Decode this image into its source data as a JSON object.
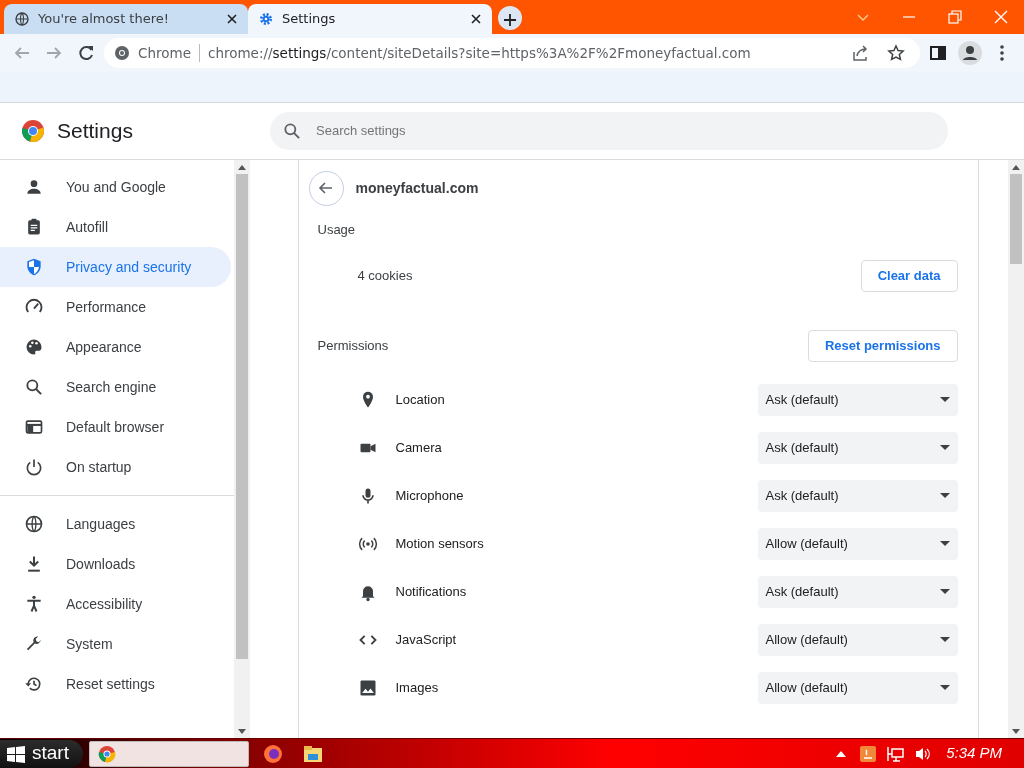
{
  "tabs": [
    {
      "title": "You're almost there!",
      "selected": false
    },
    {
      "title": "Settings",
      "selected": true
    }
  ],
  "toolbar": {
    "chip": "Chrome",
    "url_host": "chrome://",
    "url_bold": "settings",
    "url_rest": "/content/siteDetails?site=https%3A%2F%2Fmoneyfactual.com"
  },
  "header": {
    "title": "Settings",
    "search_placeholder": "Search settings"
  },
  "sidebar": {
    "groups": [
      [
        {
          "label": "You and Google",
          "selected": false
        },
        {
          "label": "Autofill",
          "selected": false
        },
        {
          "label": "Privacy and security",
          "selected": true
        },
        {
          "label": "Performance",
          "selected": false
        },
        {
          "label": "Appearance",
          "selected": false
        },
        {
          "label": "Search engine",
          "selected": false
        },
        {
          "label": "Default browser",
          "selected": false
        },
        {
          "label": "On startup",
          "selected": false
        }
      ],
      [
        {
          "label": "Languages",
          "selected": false
        },
        {
          "label": "Downloads",
          "selected": false
        },
        {
          "label": "Accessibility",
          "selected": false
        },
        {
          "label": "System",
          "selected": false
        },
        {
          "label": "Reset settings",
          "selected": false
        }
      ]
    ]
  },
  "site": {
    "name": "moneyfactual.com",
    "usage_label": "Usage",
    "cookies": "4 cookies",
    "clear_button": "Clear data",
    "permissions_label": "Permissions",
    "reset_button": "Reset permissions"
  },
  "permissions": [
    {
      "name": "Location",
      "value": "Ask (default)"
    },
    {
      "name": "Camera",
      "value": "Ask (default)"
    },
    {
      "name": "Microphone",
      "value": "Ask (default)"
    },
    {
      "name": "Motion sensors",
      "value": "Allow (default)"
    },
    {
      "name": "Notifications",
      "value": "Ask (default)"
    },
    {
      "name": "JavaScript",
      "value": "Allow (default)"
    },
    {
      "name": "Images",
      "value": "Allow (default)"
    }
  ],
  "taskbar": {
    "start": "start",
    "clock": "5:34 PM"
  }
}
